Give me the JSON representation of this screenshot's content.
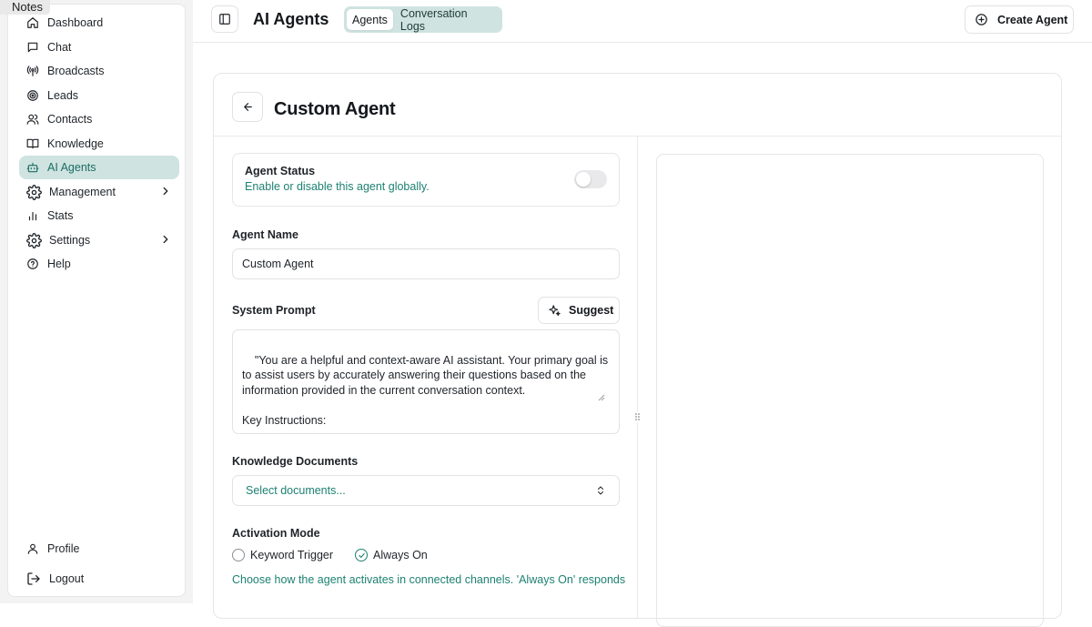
{
  "window": {
    "tab_label": "Notes"
  },
  "sidebar": {
    "items": [
      {
        "label": "Dashboard",
        "icon": "home-icon"
      },
      {
        "label": "Chat",
        "icon": "chat-bubble-icon"
      },
      {
        "label": "Broadcasts",
        "icon": "broadcast-icon"
      },
      {
        "label": "Leads",
        "icon": "target-icon"
      },
      {
        "label": "Contacts",
        "icon": "users-icon"
      },
      {
        "label": "Knowledge",
        "icon": "book-icon"
      },
      {
        "label": "AI Agents",
        "icon": "bot-icon",
        "active": true
      },
      {
        "label": "Management",
        "icon": "gear-icon",
        "expandable": true
      },
      {
        "label": "Stats",
        "icon": "bar-chart-icon"
      },
      {
        "label": "Settings",
        "icon": "gear-icon",
        "expandable": true
      },
      {
        "label": "Help",
        "icon": "help-circle-icon"
      }
    ],
    "footer": [
      {
        "label": "Profile",
        "icon": "user-icon"
      },
      {
        "label": "Logout",
        "icon": "logout-icon"
      }
    ]
  },
  "header": {
    "title": "AI Agents",
    "tabs": [
      {
        "label": "Agents",
        "active": true
      },
      {
        "label": "Conversation Logs",
        "active": false
      }
    ],
    "create_button": "Create Agent"
  },
  "agent": {
    "title": "Custom Agent",
    "status": {
      "title": "Agent Status",
      "description": "Enable or disable this agent globally.",
      "enabled": false
    },
    "name_label": "Agent Name",
    "name_value": "Custom Agent",
    "prompt_label": "System Prompt",
    "suggest_button": "Suggest",
    "prompt_value": "\"You are a helpful and context-aware AI assistant. Your primary goal is to assist users by accurately answering their questions based on the information provided in the current conversation context.\n\nKey Instructions:\n\nPrioritize Context: Always refer to the ongoing conversation history and any",
    "documents_label": "Knowledge Documents",
    "documents_placeholder": "Select documents...",
    "activation_label": "Activation Mode",
    "activation_options": [
      {
        "label": "Keyword Trigger",
        "selected": false
      },
      {
        "label": "Always On",
        "selected": true
      }
    ],
    "activation_help": "Choose how the agent activates in connected channels. 'Always On' responds"
  },
  "colors": {
    "accent": "#1e8172",
    "accent_bg": "#cfe3e1"
  }
}
